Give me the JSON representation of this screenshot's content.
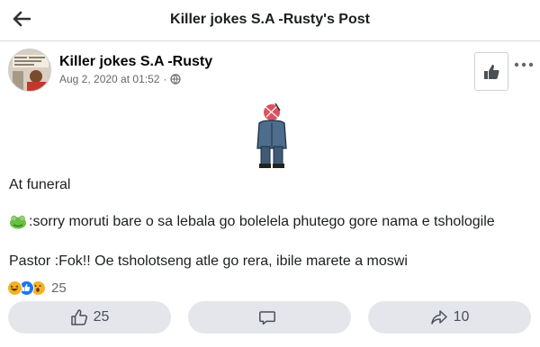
{
  "topbar": {
    "title": "Killer jokes S.A -Rusty's Post",
    "back_icon": "arrow-left-icon"
  },
  "post": {
    "author": "Killer jokes S.A -Rusty",
    "timestamp": "Aug 2, 2020 at 01:52",
    "separator": "·",
    "privacy_icon": "globe-icon",
    "like_page_icon": "thumbs-up-icon",
    "more_icon": "more-horizontal-icon",
    "sticker_icon": "sad-man-sticker-icon",
    "lines": [
      "At funeral",
      ":sorry moruti bare o sa lebala go bolelela phutego gore nama e tshologile",
      "Pastor :Fok!! Oe tsholotseng atle go rera, ibile marete a moswi"
    ],
    "line2_emoji": "frog-emoji-icon"
  },
  "reactions": {
    "icons": [
      "haha-reaction-icon",
      "like-reaction-icon",
      "wow-reaction-icon"
    ],
    "count": "25"
  },
  "actions": {
    "like_count": "25",
    "comment_label": "",
    "share_count": "10"
  },
  "colors": {
    "like_blue": "#1877f2",
    "reaction_yellow": "#f7b125",
    "button_bg": "#e4e6eb",
    "text_secondary": "#65676b"
  }
}
